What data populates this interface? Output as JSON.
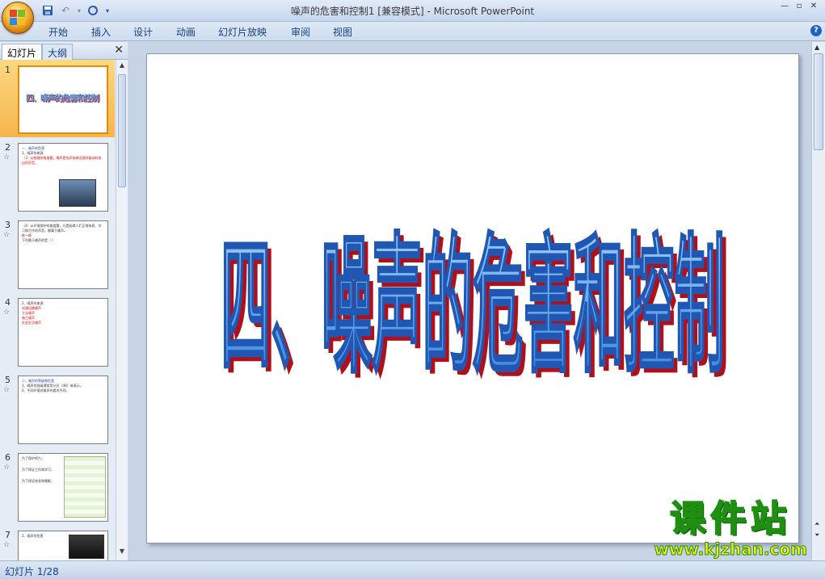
{
  "window": {
    "title": "噪声的危害和控制1 [兼容模式] - Microsoft PowerPoint",
    "controls": [
      "minimize",
      "restore",
      "close"
    ]
  },
  "qat": {
    "icons": [
      "save-icon",
      "undo-icon",
      "redo-icon",
      "customize-icon"
    ]
  },
  "ribbon": {
    "tabs": [
      "开始",
      "插入",
      "设计",
      "动画",
      "幻灯片放映",
      "审阅",
      "视图"
    ]
  },
  "pane": {
    "tabs": [
      "幻灯片",
      "大纲"
    ],
    "close_glyph": "✕"
  },
  "thumbnails": [
    {
      "number": "1",
      "anim": "",
      "lines": [
        "四、噪声的危害和控制"
      ]
    },
    {
      "number": "2",
      "anim": "☆",
      "lines": [
        "一、噪声的危害",
        "1、噪声的来源",
        "（1）从物理学角度看，噪声是发声体做无规则振动时发出的声音。"
      ]
    },
    {
      "number": "3",
      "anim": "☆",
      "lines": [
        "（2）从环境保护的角度看，凡是妨碍人们正常休息、学习和工作的声音，都属于噪声。",
        "练一练",
        "下列属于噪声的是（ ）"
      ]
    },
    {
      "number": "4",
      "anim": "☆",
      "lines": [
        "2、噪声的来源",
        "交通运输噪声",
        "工业噪声",
        "施工噪声",
        "社会生活噪声"
      ]
    },
    {
      "number": "5",
      "anim": "☆",
      "lines": [
        "二、噪声的等级和危害",
        "1、噪声的强弱通常用分贝（dB）来表示。",
        "2、不同环境对噪声的要求不同。"
      ]
    },
    {
      "number": "6",
      "anim": "☆",
      "lines": [
        "为了保护听力，",
        "为了保证工作和学习，",
        "为了保证休息和睡眠，"
      ]
    },
    {
      "number": "7",
      "anim": "☆",
      "lines": [
        "3、噪声的危害"
      ]
    }
  ],
  "slide": {
    "title": "四、噪声的危害和控制"
  },
  "status": {
    "slide_counter": "幻灯片 1/28"
  },
  "watermark": {
    "text": "课件站",
    "url": "www.kjzhan.com"
  },
  "colors": {
    "slide_title_fill": "#5aa6e8",
    "slide_title_edge": "#1f57b3",
    "slide_title_shadow": "#b0101a",
    "selected_thumb": "#f6b54c"
  }
}
